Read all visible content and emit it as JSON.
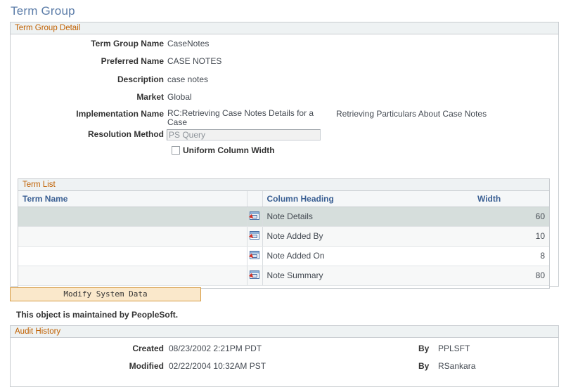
{
  "page": {
    "title": "Term Group",
    "title_color": "#5b7ca8"
  },
  "detail": {
    "section_title": "Term Group Detail",
    "fields": [
      {
        "label": "Term Group Name",
        "value": "CaseNotes"
      },
      {
        "label": "Preferred Name",
        "value": "CASE NOTES"
      },
      {
        "label": "Description",
        "value": "case notes"
      },
      {
        "label": "Market",
        "value": "Global"
      }
    ],
    "implementation": {
      "label": "Implementation Name",
      "value": "RC:Retrieving Case Notes Details for a Case",
      "secondary_value": "Retrieving Particulars About Case Notes"
    },
    "resolution": {
      "label": "Resolution Method",
      "value": "PS Query",
      "readonly": "true"
    },
    "uniform_column_width": {
      "label": "Uniform Column Width",
      "checked": "false"
    }
  },
  "term_list": {
    "section_title": "Term List",
    "columns": {
      "term_name": "Term Name",
      "icon": "",
      "column_heading": "Column Heading",
      "width": "Width"
    },
    "rows": [
      {
        "term_name": "",
        "icon": "related-content-icon",
        "column_heading": "Note Details",
        "width": "60"
      },
      {
        "term_name": "",
        "icon": "related-content-icon",
        "column_heading": "Note Added By",
        "width": "10"
      },
      {
        "term_name": "",
        "icon": "related-content-icon",
        "column_heading": "Note Added On",
        "width": "8"
      },
      {
        "term_name": "",
        "icon": "related-content-icon",
        "column_heading": "Note Summary",
        "width": "80"
      }
    ]
  },
  "actions": {
    "modify_system_data": "Modify System Data"
  },
  "maintained_note": "This object is maintained by PeopleSoft.",
  "audit": {
    "section_title": "Audit History",
    "created": {
      "label": "Created",
      "value": "08/23/2002  2:21PM PDT",
      "by_label": "By",
      "by_value": "PPLSFT"
    },
    "modified": {
      "label": "Modified",
      "value": "02/22/2004 10:32AM PST",
      "by_label": "By",
      "by_value": "RSankara"
    }
  },
  "colors": {
    "section_header_bg": "#eef2f3",
    "section_header_text": "#c06000",
    "grid_header_text": "#3a5f93",
    "selected_row_bg": "#d6dedc",
    "button_bg": "#fae8cb",
    "button_border": "#d79c45"
  }
}
